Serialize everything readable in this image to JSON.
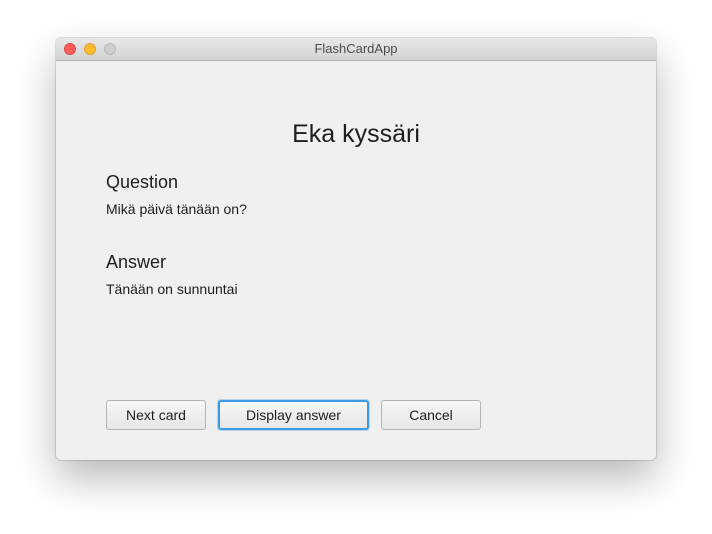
{
  "window": {
    "title": "FlashCardApp"
  },
  "card": {
    "title": "Eka kyssäri",
    "question_heading": "Question",
    "question_text": "Mikä päivä tänään on?",
    "answer_heading": "Answer",
    "answer_text": "Tänään on sunnuntai"
  },
  "buttons": {
    "next": "Next card",
    "display": "Display answer",
    "cancel": "Cancel"
  },
  "colors": {
    "focus_ring": "#3d9be0",
    "close": "#fc5f57",
    "minimize": "#fdbc2e",
    "zoom_disabled": "#cfcfcf"
  }
}
